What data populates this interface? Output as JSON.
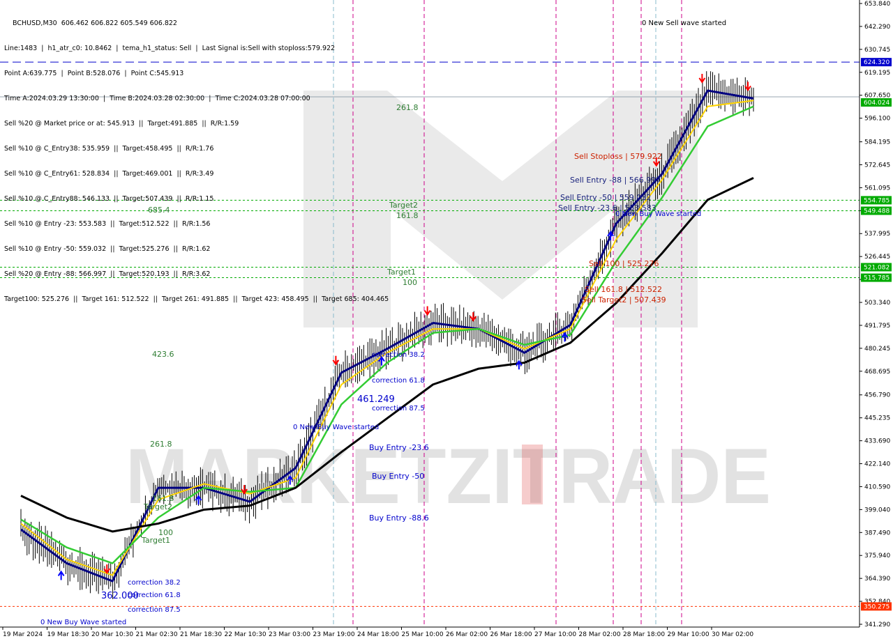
{
  "window": {
    "symbol_line": "BCHUSD,M30  606.462 606.822 605.549 606.822"
  },
  "info_lines": [
    "Line:1483  |  h1_atr_c0: 10.8462  |  tema_h1_status: Sell  |  Last Signal is:Sell with stoploss:579.922",
    "Point A:639.775  |  Point B:528.076  |  Point C:545.913",
    "Time A:2024.03.29 13:30:00  |  Time B:2024.03.28 02:30:00  |  Time C:2024.03.28 07:00:00",
    "Sell %20 @ Market price or at: 545.913  ||  Target:491.885  ||  R/R:1.59",
    "Sell %10 @ C_Entry38: 535.959  ||  Target:458.495  ||  R/R:1.76",
    "Sell %10 @ C_Entry61: 528.834  ||  Target:469.001  ||  R/R:3.49",
    "Sell %10 @ C_Entry88: 546.133  ||  Target:507.439  ||  R/R:1.15",
    "Sell %10 @ Entry -23: 553.583  ||  Target:512.522  ||  R/R:1.56",
    "Sell %10 @ Entry -50: 559.032  ||  Target:525.276  ||  R/R:1.62",
    "Sell %20 @ Entry -88: 566.997  ||  Target:520.193  ||  R/R:3.62",
    "Target100: 525.276  ||  Target 161: 512.522  ||  Target 261: 491.885  ||  Target 423: 458.495  ||  Target 685: 404.465"
  ],
  "price_axis": {
    "ticks": [
      "653.840",
      "642.290",
      "630.745",
      "619.195",
      "607.650",
      "596.100",
      "584.195",
      "572.645",
      "561.095",
      "549.550",
      "537.995",
      "526.445",
      "514.895",
      "503.340",
      "491.795",
      "480.245",
      "468.695",
      "456.790",
      "445.235",
      "433.690",
      "422.140",
      "410.590",
      "399.040",
      "387.490",
      "375.940",
      "364.390",
      "352.840",
      "341.290"
    ],
    "current_price": "606.822",
    "current_price_label": "604.024",
    "levels": [
      {
        "value": "624.320",
        "color": "#0000cc"
      },
      {
        "value": "554.785",
        "color": "#00aa00"
      },
      {
        "value": "549.488",
        "color": "#00aa00"
      },
      {
        "value": "521.082",
        "color": "#00aa00"
      },
      {
        "value": "515.785",
        "color": "#00aa00"
      },
      {
        "value": "350.275",
        "color": "#ff3300"
      }
    ]
  },
  "time_axis": {
    "labels": [
      "19 Mar 2024",
      "19 Mar 18:30",
      "20 Mar 10:30",
      "21 Mar 02:30",
      "21 Mar 18:30",
      "22 Mar 10:30",
      "23 Mar 03:00",
      "23 Mar 19:00",
      "24 Mar 18:00",
      "25 Mar 10:00",
      "26 Mar 02:00",
      "26 Mar 18:00",
      "27 Mar 10:00",
      "28 Mar 02:00",
      "28 Mar 18:00",
      "29 Mar 10:00",
      "30 Mar 02:00"
    ]
  },
  "annotations": [
    {
      "text": "0 New Sell wave started",
      "color": "#000000"
    },
    {
      "text": "261.8",
      "color": "#2e7d32"
    },
    {
      "text": "685.4",
      "color": "#2e7d32"
    },
    {
      "text": "Target2",
      "color": "#2e7d32"
    },
    {
      "text": "161.8",
      "color": "#2e7d32"
    },
    {
      "text": "Target1",
      "color": "#2e7d32"
    },
    {
      "text": "100",
      "color": "#2e7d32"
    },
    {
      "text": "423.6",
      "color": "#2e7d32"
    },
    {
      "text": "Sell Stoploss | 579.922",
      "color": "#cc2200"
    },
    {
      "text": "Sell Entry -88 | 566.997",
      "color": "#1a237e"
    },
    {
      "text": "Sell Entry -50 | 559.032",
      "color": "#1a237e"
    },
    {
      "text": "Sell Entry -23.6 | 553.583",
      "color": "#1a237e"
    },
    {
      "text": "0 New Buy Wave started",
      "color": "#0000cc"
    },
    {
      "text": "Sell 100 | 525.276",
      "color": "#cc2200"
    },
    {
      "text": "Sell 161.8 | 512.522",
      "color": "#cc2200"
    },
    {
      "text": "Sell Target2 | 507.439",
      "color": "#cc2200"
    },
    {
      "text": "correction 38.2",
      "color": "#0000cc"
    },
    {
      "text": "correction 61.8",
      "color": "#0000cc"
    },
    {
      "text": "461.249",
      "color": "#0000cc"
    },
    {
      "text": "correction 87.5",
      "color": "#0000cc"
    },
    {
      "text": "0 New Buy Wave started",
      "color": "#0000cc"
    },
    {
      "text": "Buy Entry -23.6",
      "color": "#0000cc"
    },
    {
      "text": "Buy Entry -50",
      "color": "#0000cc"
    },
    {
      "text": "Buy Entry -88.6",
      "color": "#0000cc"
    },
    {
      "text": "261.8",
      "color": "#2e7d32"
    },
    {
      "text": "161.8",
      "color": "#2e7d32"
    },
    {
      "text": "Target2",
      "color": "#2e7d32"
    },
    {
      "text": "100",
      "color": "#2e7d32"
    },
    {
      "text": "Target1",
      "color": "#2e7d32"
    },
    {
      "text": "correction 38.2",
      "color": "#0000cc"
    },
    {
      "text": "correction 61.8",
      "color": "#0000cc"
    },
    {
      "text": "362.000",
      "color": "#0000cc"
    },
    {
      "text": "correction 87.5",
      "color": "#0000cc"
    },
    {
      "text": "0 New Buy Wave started",
      "color": "#0000cc"
    }
  ],
  "watermark": "MARKETZITRADE",
  "chart_data": {
    "type": "line",
    "title": "BCHUSD,M30",
    "xlabel": "",
    "ylabel": "",
    "ylim": [
      341.29,
      653.84
    ],
    "x": [
      "19 Mar 2024",
      "19 Mar 18:30",
      "20 Mar 10:30",
      "21 Mar 02:30",
      "21 Mar 18:30",
      "22 Mar 10:30",
      "23 Mar 03:00",
      "23 Mar 19:00",
      "24 Mar 18:00",
      "25 Mar 10:00",
      "26 Mar 02:00",
      "26 Mar 18:00",
      "27 Mar 10:00",
      "28 Mar 02:00",
      "28 Mar 18:00",
      "29 Mar 10:00",
      "30 Mar 02:00"
    ],
    "series": [
      {
        "values": [
          389,
          372,
          363,
          410,
          410,
          403,
          420,
          468,
          480,
          493,
          490,
          478,
          492,
          543,
          568,
          610,
          606
        ],
        "color": "#000080"
      },
      {
        "values": [
          392,
          374,
          366,
          404,
          412,
          407,
          415,
          462,
          478,
          490,
          490,
          480,
          490,
          535,
          565,
          602,
          605
        ],
        "color": "#ffd400"
      },
      {
        "values": [
          394,
          380,
          372,
          395,
          410,
          408,
          410,
          452,
          473,
          488,
          490,
          482,
          487,
          524,
          556,
          592,
          602
        ],
        "color": "#33cc33"
      },
      {
        "values": [
          406,
          395,
          388,
          392,
          399,
          401,
          410,
          428,
          445,
          462,
          470,
          473,
          483,
          503,
          528,
          555,
          566
        ],
        "color": "#000000"
      }
    ],
    "levels": [
      624.32,
      554.785,
      549.488,
      521.082,
      515.785,
      350.275
    ]
  }
}
